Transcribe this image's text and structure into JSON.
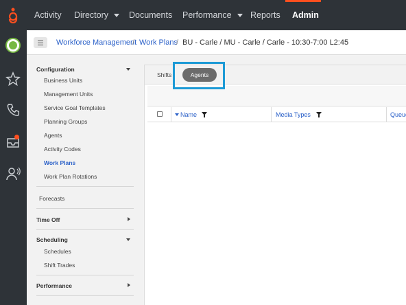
{
  "topnav": {
    "items": [
      "Activity",
      "Directory",
      "Documents",
      "Performance",
      "Reports",
      "Admin"
    ],
    "active_accent": "#ff4f1f"
  },
  "rail": {
    "icons": [
      "avatar",
      "star-icon",
      "phone-icon",
      "inbox-icon",
      "agent-icon"
    ]
  },
  "breadcrumb": {
    "items": [
      "Workforce Management",
      "Work Plans",
      "BU - Carle / MU - Carle / Carle - 10:30-7:00 L2:45"
    ]
  },
  "sidebar": {
    "configuration": "Configuration",
    "config_items": [
      "Business Units",
      "Management Units",
      "Service Goal Templates",
      "Planning Groups",
      "Agents",
      "Activity Codes",
      "Work Plans",
      "Work Plan Rotations"
    ],
    "forecasts": "Forecasts",
    "time_off": "Time Off",
    "scheduling": "Scheduling",
    "scheduling_items": [
      "Schedules",
      "Shift Trades"
    ],
    "performance": "Performance"
  },
  "main": {
    "tabs": [
      "Shifts",
      "Agents"
    ],
    "selected_tab": "Agents",
    "columns": [
      "Name",
      "Media Types",
      "Queue"
    ],
    "highlight_color": "#1d9ad6"
  }
}
